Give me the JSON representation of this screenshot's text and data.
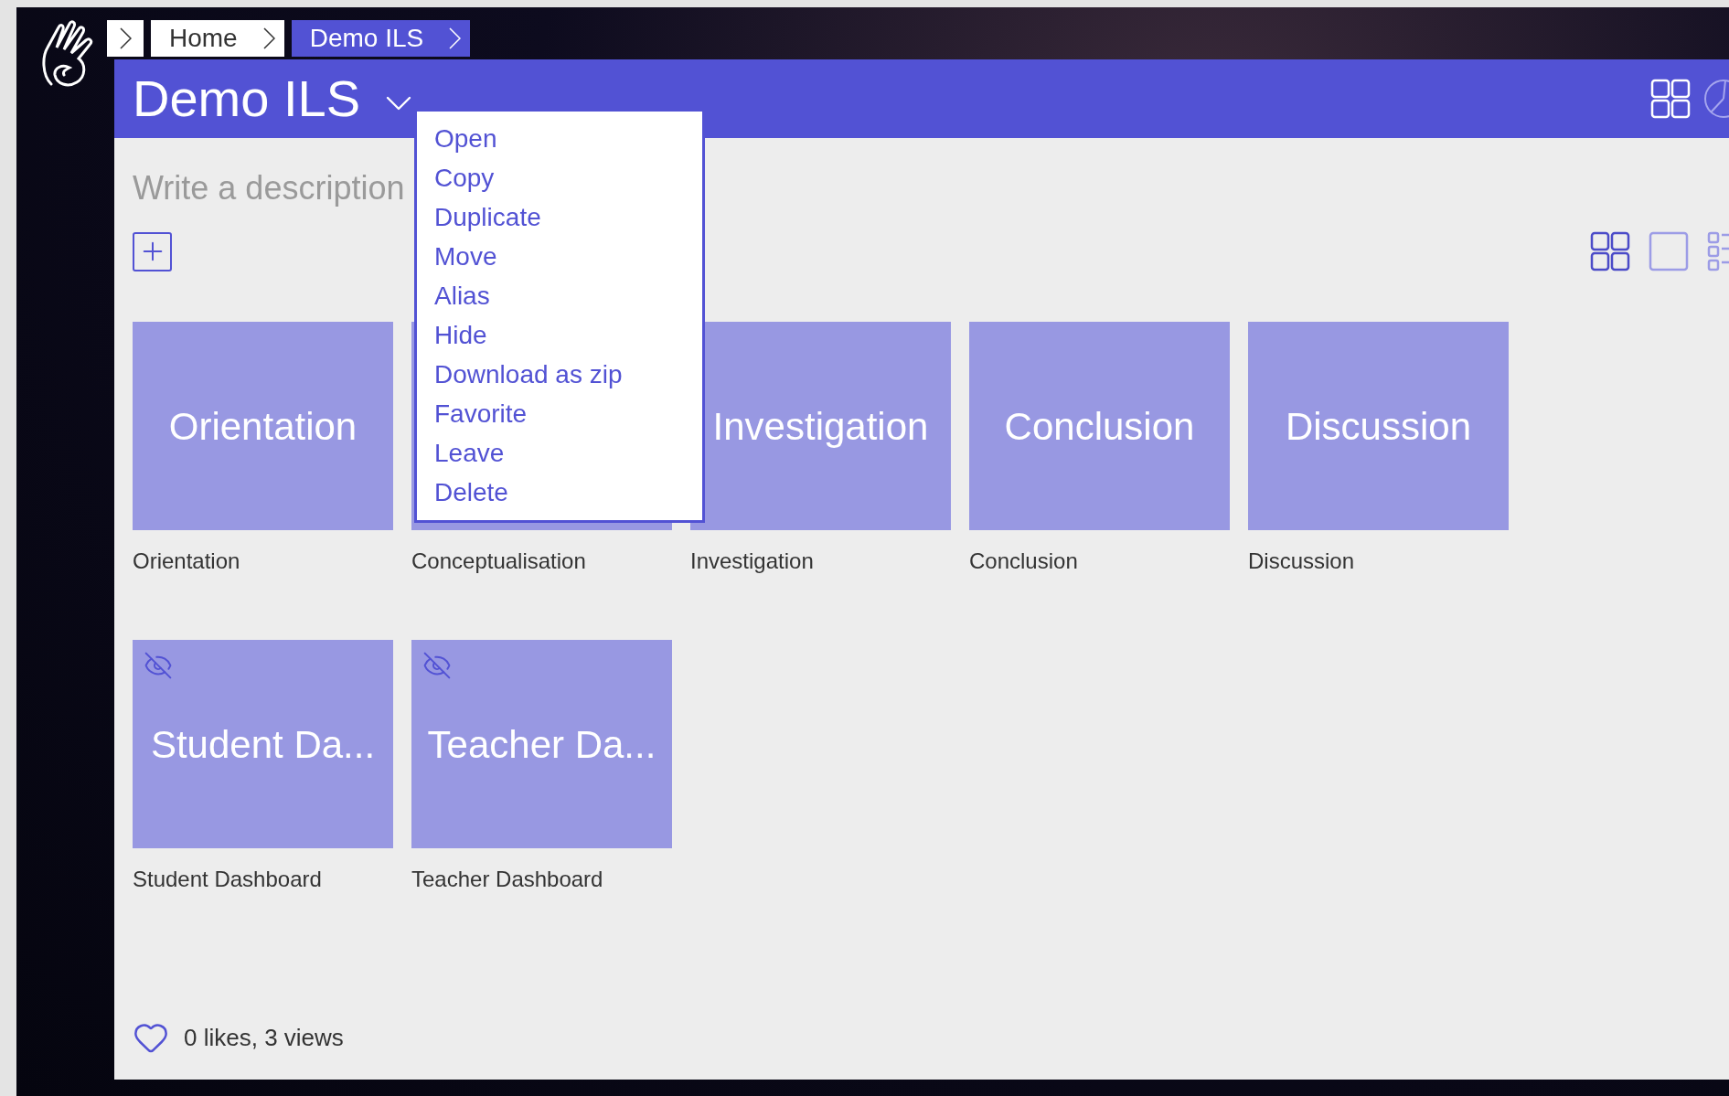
{
  "breadcrumbs": [
    {
      "label": "Home",
      "selected": false
    },
    {
      "label": "Demo ILS",
      "selected": true
    }
  ],
  "header": {
    "title": "Demo ILS"
  },
  "menu": {
    "expanded": true,
    "items": [
      "Open",
      "Copy",
      "Duplicate",
      "Move",
      "Alias",
      "Hide",
      "Download as zip",
      "Favorite",
      "Leave",
      "Delete"
    ]
  },
  "description": {
    "placeholder": "Write a description"
  },
  "view_modes": [
    {
      "kind": "grid",
      "selected": true
    },
    {
      "kind": "single",
      "selected": false
    },
    {
      "kind": "list",
      "selected": false
    }
  ],
  "cards": [
    {
      "tile_text": "Orientation",
      "label": "Orientation",
      "hidden": false
    },
    {
      "label": "Conceptualisation"
    },
    {
      "tile_text": "Investigation",
      "label": "Investigation",
      "hidden": false
    },
    {
      "tile_text": "Conclusion",
      "label": "Conclusion",
      "hidden": false
    },
    {
      "tile_text": "Discussion",
      "label": "Discussion",
      "hidden": false
    },
    {
      "tile_text": "Student Da...",
      "label": "Student Dashboard",
      "hidden": true
    },
    {
      "tile_text": "Teacher Da...",
      "label": "Teacher Dashboard",
      "hidden": true
    }
  ],
  "footer": {
    "stats": "0 likes, 3 views"
  }
}
